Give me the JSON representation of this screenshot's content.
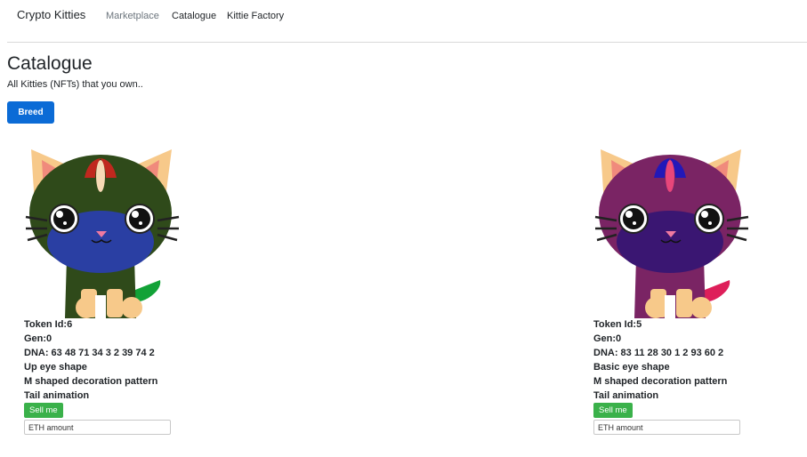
{
  "nav": {
    "brand": "Crypto Kitties",
    "links": [
      "Marketplace",
      "Catalogue",
      "Kittie Factory"
    ]
  },
  "page": {
    "title": "Catalogue",
    "subtitle": "All Kitties (NFTs) that you own..",
    "breed_button": "Breed"
  },
  "kitties": [
    {
      "token": "Token Id:6",
      "gen": "Gen:0",
      "dna": "DNA: 63 48 71 34 3 2 39 74 2",
      "eye_shape": "Up eye shape",
      "decoration": "M shaped decoration pattern",
      "animation": "Tail animation",
      "sell_label": "Sell me",
      "eth_placeholder": "ETH amount",
      "colors": {
        "body": "#2f4a1a",
        "face": "#2a3fa3",
        "ear_inner": "#f08a7c",
        "ear_outer": "#f7c98a",
        "deco_mid": "#f7d9b5",
        "deco_side": "#c0281e",
        "tail": "#12a237",
        "paws": "#f7c98a"
      }
    },
    {
      "token": "Token Id:5",
      "gen": "Gen:0",
      "dna": "DNA: 83 11 28 30 1 2 93 60 2",
      "eye_shape": "Basic eye shape",
      "decoration": "M shaped decoration pattern",
      "animation": "Tail animation",
      "sell_label": "Sell me",
      "eth_placeholder": "ETH amount",
      "colors": {
        "body": "#7a2464",
        "face": "#3a1672",
        "ear_inner": "#f08a7c",
        "ear_outer": "#f7c98a",
        "deco_mid": "#e8467a",
        "deco_side": "#2218b8",
        "tail": "#de1f5a",
        "paws": "#f7c98a"
      }
    }
  ]
}
